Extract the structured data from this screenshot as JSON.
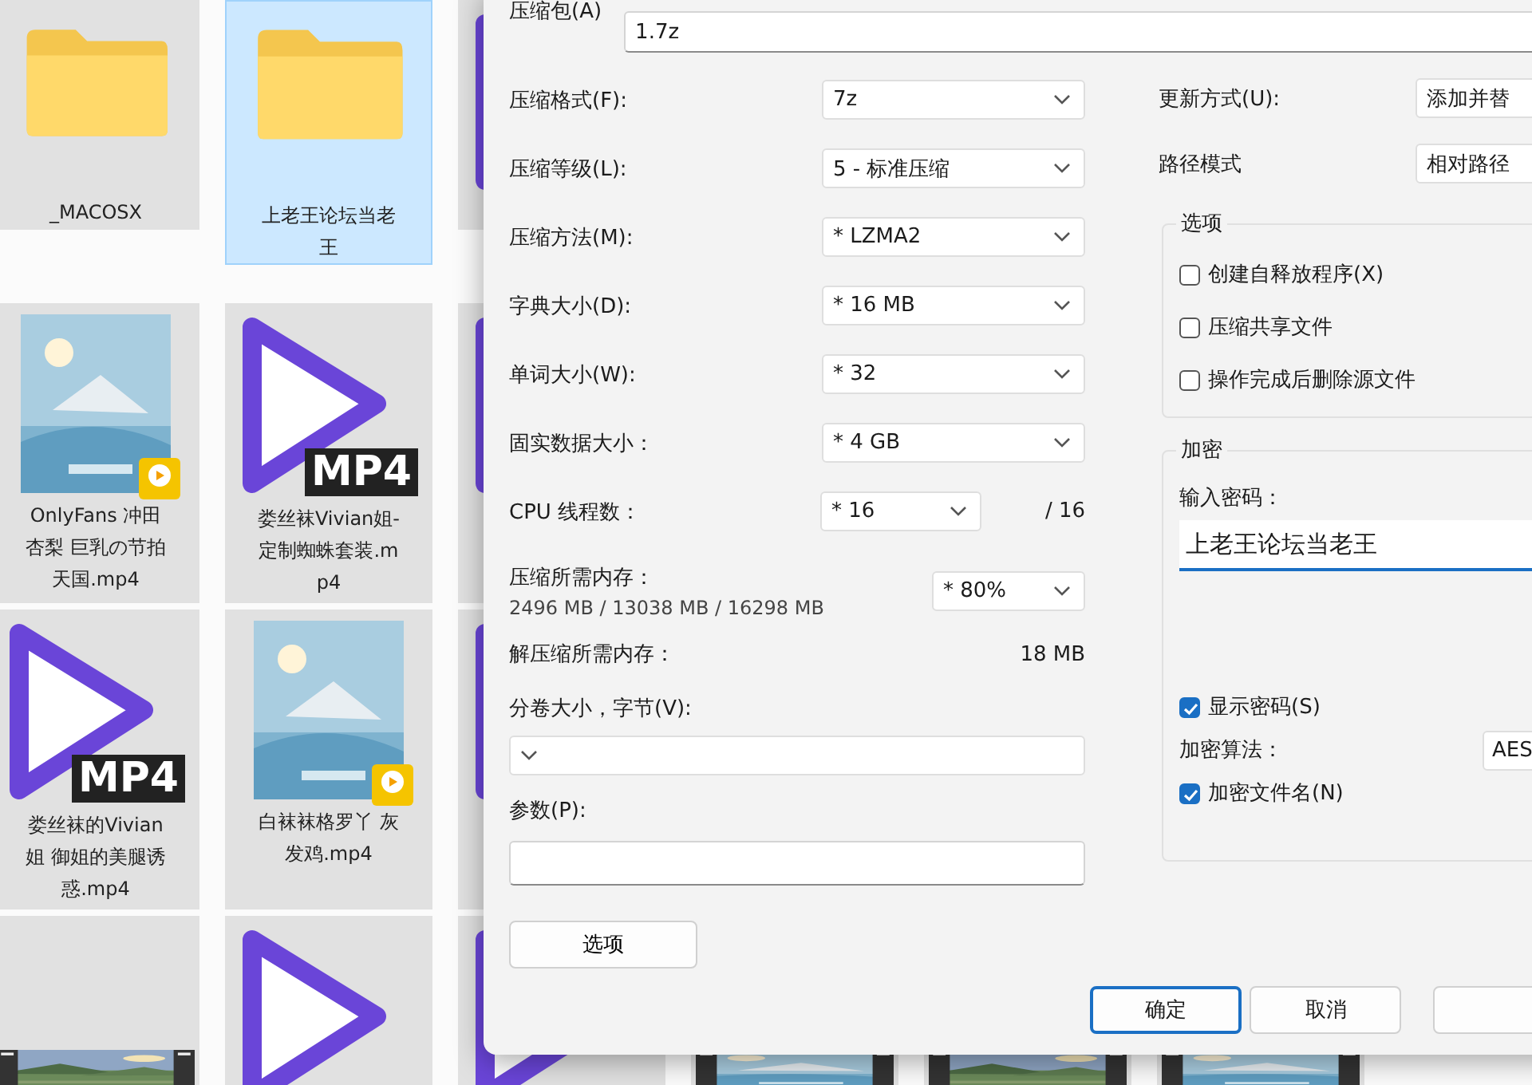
{
  "explorer": {
    "rows": [
      {
        "tiles": [
          {
            "kind": "folder",
            "label": "_MACOSX",
            "selected": false
          },
          {
            "kind": "folder",
            "label": "上老王论坛当老王",
            "selected": true
          },
          {
            "kind": "mp4",
            "selected": false
          }
        ]
      },
      {
        "tiles": [
          {
            "kind": "video",
            "label": "OnlyFans 冲田杏梨 巨乳の节拍天国.mp4",
            "selected": false
          },
          {
            "kind": "mp4",
            "badge": "MP4",
            "label": "娄丝袜Vivian姐-定制蜘蛛套装.mp4",
            "selected": false
          },
          {
            "kind": "mp4",
            "selected": false
          }
        ]
      },
      {
        "tiles": [
          {
            "kind": "mp4",
            "badge": "MP4",
            "label": "娄丝袜的Vivian姐 御姐的美腿诱惑.mp4",
            "selected": false
          },
          {
            "kind": "video",
            "label": "白袜袜格罗丫 灰发鸡.mp4",
            "selected": false
          },
          {
            "kind": "mp4",
            "selected": false
          }
        ]
      },
      {
        "tiles": [
          {
            "kind": "film",
            "selected": false
          },
          {
            "kind": "mp4",
            "selected": false
          },
          {
            "kind": "mp4",
            "selected": false
          },
          {
            "kind": "film",
            "selected": false
          },
          {
            "kind": "film",
            "selected": false
          },
          {
            "kind": "film",
            "selected": false
          }
        ]
      }
    ]
  },
  "dialog": {
    "archive": {
      "label": "压缩包(A)",
      "value": "1.7z"
    },
    "settings": [
      {
        "label": "压缩格式(F):",
        "value": "7z"
      },
      {
        "label": "压缩等级(L):",
        "value": "5 - 标准压缩"
      },
      {
        "label": "压缩方法(M):",
        "value": "* LZMA2"
      },
      {
        "label": "字典大小(D):",
        "value": "* 16 MB"
      },
      {
        "label": "单词大小(W):",
        "value": "* 32"
      },
      {
        "label": "固实数据大小：",
        "value": "* 4 GB"
      }
    ],
    "threads": {
      "label": "CPU 线程数：",
      "value": "* 16",
      "total": "/ 16"
    },
    "memory": {
      "label": "压缩所需内存：",
      "detail": "2496 MB / 13038 MB / 16298 MB",
      "value": "* 80%"
    },
    "decompress_memory": {
      "label": "解压缩所需内存：",
      "value": "18 MB"
    },
    "volume": {
      "label": "分卷大小，字节(V):"
    },
    "parameters": {
      "label": "参数(P):"
    },
    "options_button": "选项",
    "update_mode": {
      "label": "更新方式(U):",
      "value": "添加并替"
    },
    "path_mode": {
      "label": "路径模式",
      "value": "相对路径"
    },
    "options_group": {
      "title": "选项",
      "checkboxes": [
        {
          "label": "创建自释放程序(X)",
          "checked": false
        },
        {
          "label": "压缩共享文件",
          "checked": false
        },
        {
          "label": "操作完成后删除源文件",
          "checked": false
        }
      ]
    },
    "encryption": {
      "title": "加密",
      "password_label": "输入密码：",
      "password": "上老王论坛当老王",
      "show_password": {
        "label": "显示密码(S)",
        "checked": true
      },
      "method_label": "加密算法：",
      "method": "AES",
      "encrypt_names": {
        "label": "加密文件名(N)",
        "checked": true
      }
    },
    "buttons": [
      {
        "label": "确定",
        "default": true
      },
      {
        "label": "取消",
        "default": false
      },
      {
        "default": false
      }
    ]
  }
}
